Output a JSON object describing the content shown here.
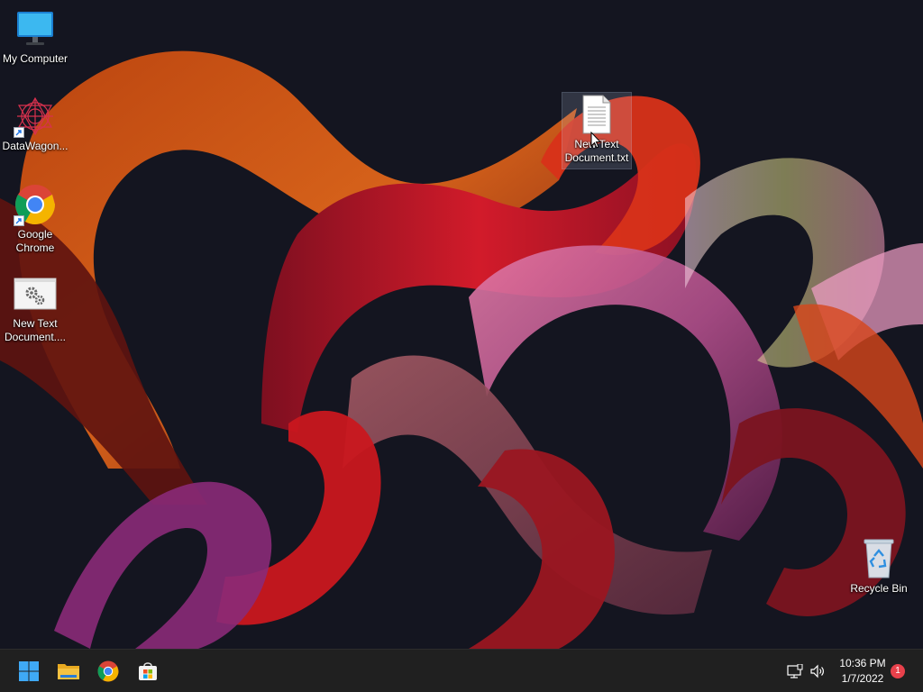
{
  "desktop": {
    "icons": [
      {
        "label": "My Computer",
        "icon": "monitor-icon"
      },
      {
        "label": "DataWagon...",
        "icon": "datawagon-icon",
        "shortcut": true
      },
      {
        "label": "Google Chrome",
        "icon": "chrome-icon",
        "shortcut": true
      },
      {
        "label": "New Text Document....",
        "icon": "settings-document-icon"
      },
      {
        "label": "New Text Document.txt",
        "icon": "text-file-icon",
        "selected": true
      },
      {
        "label": "Recycle Bin",
        "icon": "recycle-bin-icon"
      }
    ]
  },
  "taskbar": {
    "pinned": [
      {
        "name": "Start",
        "icon": "windows-start-icon"
      },
      {
        "name": "File Explorer",
        "icon": "folder-icon"
      },
      {
        "name": "Google Chrome",
        "icon": "chrome-icon"
      },
      {
        "name": "Microsoft Store",
        "icon": "store-icon"
      }
    ],
    "tray": {
      "network_icon": "network-icon",
      "volume_icon": "speaker-icon"
    },
    "clock": {
      "time": "10:36 PM",
      "date": "1/7/2022"
    },
    "notifications": {
      "count": "1"
    }
  },
  "colors": {
    "taskbar_bg": "#202020",
    "desktop_bg": "#12131c",
    "accent_blue": "#0078d4",
    "badge_red": "#e8414b",
    "folder_yellow": "#f5c242"
  }
}
